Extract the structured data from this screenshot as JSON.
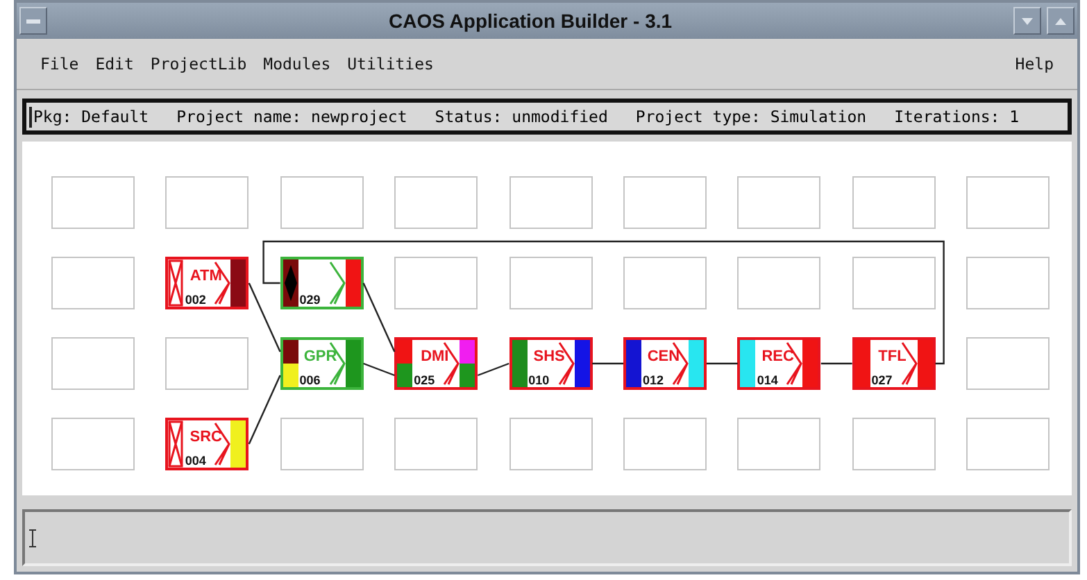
{
  "window": {
    "title": "CAOS Application Builder - 3.1"
  },
  "menu": {
    "items": [
      "File",
      "Edit",
      "ProjectLib",
      "Modules",
      "Utilities"
    ],
    "help": "Help"
  },
  "info_bar": [
    "Pkg: Default",
    "Project name: newproject",
    "Status: unmodified",
    "Project type: Simulation",
    "Iterations: 1"
  ],
  "canvas": {
    "rows": [
      {
        "cells": [
          {
            "kind": "empty"
          },
          {
            "kind": "empty"
          },
          {
            "kind": "empty"
          },
          {
            "kind": "empty"
          },
          {
            "kind": "empty"
          },
          {
            "kind": "empty"
          },
          {
            "kind": "empty"
          },
          {
            "kind": "empty"
          },
          {
            "kind": "empty"
          }
        ]
      },
      {
        "cells": [
          {
            "kind": "empty"
          },
          {
            "kind": "module",
            "name": "ATM",
            "number": "002",
            "color": "#e8141e",
            "outputs": [
              {
                "color": "#8b0a14"
              }
            ]
          },
          {
            "kind": "feedback",
            "number": "029",
            "color": "#3cb43c",
            "inputs": [
              {
                "color": "#7a0a0a"
              }
            ],
            "outputs": [
              {
                "color": "#f01414"
              }
            ]
          },
          {
            "kind": "empty"
          },
          {
            "kind": "empty"
          },
          {
            "kind": "empty"
          },
          {
            "kind": "empty"
          },
          {
            "kind": "empty"
          },
          {
            "kind": "empty"
          }
        ]
      },
      {
        "cells": [
          {
            "kind": "empty"
          },
          {
            "kind": "empty"
          },
          {
            "kind": "module",
            "name": "GPR",
            "number": "006",
            "color": "#3cb43c",
            "inputs": [
              {
                "color": "#7a0a0a"
              },
              {
                "color": "#f0f01e"
              }
            ],
            "outputs": [
              {
                "color": "#1e961e"
              }
            ]
          },
          {
            "kind": "module",
            "name": "DMI",
            "number": "025",
            "color": "#e8141e",
            "inputs": [
              {
                "color": "#f01414"
              },
              {
                "color": "#1e961e"
              }
            ],
            "outputs": [
              {
                "color": "#f01ef0"
              },
              {
                "color": "#1e961e"
              }
            ]
          },
          {
            "kind": "module",
            "name": "SHS",
            "number": "010",
            "color": "#e8141e",
            "inputs": [
              {
                "color": "#1e8c1e"
              }
            ],
            "outputs": [
              {
                "color": "#1414e6"
              }
            ]
          },
          {
            "kind": "module",
            "name": "CEN",
            "number": "012",
            "color": "#e8141e",
            "inputs": [
              {
                "color": "#1414d2"
              }
            ],
            "outputs": [
              {
                "color": "#28e6f0"
              }
            ]
          },
          {
            "kind": "module",
            "name": "REC",
            "number": "014",
            "color": "#e8141e",
            "inputs": [
              {
                "color": "#28e6f0"
              }
            ],
            "outputs": [
              {
                "color": "#f01414"
              }
            ]
          },
          {
            "kind": "module",
            "name": "TFL",
            "number": "027",
            "color": "#e8141e",
            "inputs": [
              {
                "color": "#f01414"
              }
            ],
            "outputs": [
              {
                "color": "#f01414"
              }
            ]
          },
          {
            "kind": "empty"
          }
        ]
      },
      {
        "cells": [
          {
            "kind": "empty"
          },
          {
            "kind": "module",
            "name": "SRC",
            "number": "004",
            "color": "#e8141e",
            "outputs": [
              {
                "color": "#f0f01e"
              }
            ]
          },
          {
            "kind": "empty"
          },
          {
            "kind": "empty"
          },
          {
            "kind": "empty"
          },
          {
            "kind": "empty"
          },
          {
            "kind": "empty"
          },
          {
            "kind": "empty"
          },
          {
            "kind": "empty"
          }
        ]
      }
    ]
  }
}
